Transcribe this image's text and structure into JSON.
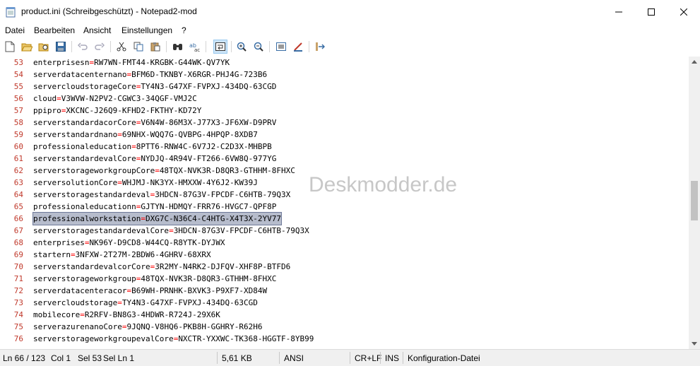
{
  "window": {
    "title": "product.ini (Schreibgeschützt) - Notepad2-mod",
    "buttons": [
      "minimize-icon",
      "maximize-icon",
      "close-icon"
    ]
  },
  "menu": [
    "Datei",
    "Bearbeiten",
    "Ansicht",
    "Einstellungen",
    "?"
  ],
  "toolbar": {
    "icons": [
      "new-file-icon",
      "open-folder-icon",
      "browse-icon",
      "save-icon",
      "undo-icon",
      "redo-icon",
      "cut-icon",
      "copy-icon",
      "paste-icon",
      "find-icon",
      "replace-icon",
      "word-wrap-icon",
      "zoom-in-icon",
      "zoom-out-icon",
      "scheme-icon",
      "customize-scheme-icon",
      "exit-icon"
    ],
    "active": "word-wrap-icon"
  },
  "editor": {
    "selected_line": "66",
    "lines": [
      {
        "n": "53",
        "key": "enterprisesn",
        "val": "RW7WN-FMT44-KRGBK-G44WK-QV7YK"
      },
      {
        "n": "54",
        "key": "serverdatacenternano",
        "val": "BFM6D-TKNBY-X6RGR-PHJ4G-723B6"
      },
      {
        "n": "55",
        "key": "servercloudstorageCore",
        "val": "TY4N3-G47XF-FVPXJ-434DQ-63CGD"
      },
      {
        "n": "56",
        "key": "cloud",
        "val": "V3WVW-N2PV2-CGWC3-34QGF-VMJ2C"
      },
      {
        "n": "57",
        "key": "ppipro",
        "val": "XKCNC-J26Q9-KFHD2-FKTHY-KD72Y"
      },
      {
        "n": "58",
        "key": "serverstandardacorCore",
        "val": "V6N4W-86M3X-J77X3-JF6XW-D9PRV"
      },
      {
        "n": "59",
        "key": "serverstandardnano",
        "val": "69NHX-WQQ7G-QVBPG-4HPQP-8XDB7"
      },
      {
        "n": "60",
        "key": "professionaleducation",
        "val": "8PTT6-RNW4C-6V7J2-C2D3X-MHBPB"
      },
      {
        "n": "61",
        "key": "serverstandardevalCore",
        "val": "NYDJQ-4R94V-FT266-6VW8Q-977YG"
      },
      {
        "n": "62",
        "key": "serverstorageworkgroupCore",
        "val": "48TQX-NVK3R-D8QR3-GTHHM-8FHXC"
      },
      {
        "n": "63",
        "key": "serversolutionCore",
        "val": "WHJMJ-NK3YX-HMXXW-4Y6J2-KW39J"
      },
      {
        "n": "64",
        "key": "serverstoragestandardeval",
        "val": "3HDCN-87G3V-FPCDF-C6HTB-79Q3X"
      },
      {
        "n": "65",
        "key": "professionaleducationn",
        "val": "GJTYN-HDMQY-FRR76-HVGC7-QPF8P"
      },
      {
        "n": "66",
        "key": "professionalworkstation",
        "val": "DXG7C-N36C4-C4HTG-X4T3X-2YV77"
      },
      {
        "n": "67",
        "key": "serverstoragestandardevalCore",
        "val": "3HDCN-87G3V-FPCDF-C6HTB-79Q3X"
      },
      {
        "n": "68",
        "key": "enterprises",
        "val": "NK96Y-D9CD8-W44CQ-R8YTK-DYJWX"
      },
      {
        "n": "69",
        "key": "startern",
        "val": "3NFXW-2T27M-2BDW6-4GHRV-68XRX"
      },
      {
        "n": "70",
        "key": "serverstandardevalcorCore",
        "val": "3R2MY-N4RK2-DJFQV-XHF8P-BTFD6"
      },
      {
        "n": "71",
        "key": "serverstorageworkgroup",
        "val": "48TQX-NVK3R-D8QR3-GTHHM-8FHXC"
      },
      {
        "n": "72",
        "key": "serverdatacenteracor",
        "val": "B69WH-PRNHK-BXVK3-P9XF7-XD84W"
      },
      {
        "n": "73",
        "key": "servercloudstorage",
        "val": "TY4N3-G47XF-FVPXJ-434DQ-63CGD"
      },
      {
        "n": "74",
        "key": "mobilecore",
        "val": "R2RFV-BN8G3-4HDWR-R724J-29X6K"
      },
      {
        "n": "75",
        "key": "serverazurenanoCore",
        "val": "9JQNQ-V8HQ6-PKB8H-GGHRY-R62H6"
      },
      {
        "n": "76",
        "key": "serverstorageworkgroupevalCore",
        "val": "NXCTR-YXXWC-TK368-HGGTF-8YB99"
      }
    ]
  },
  "watermark": "Deskmodder.de",
  "status": {
    "position": "Ln 66 / 123",
    "col": "Col 1",
    "sel": "Sel 53",
    "selln": "Sel Ln 1",
    "size": "5,61 KB",
    "encoding": "ANSI",
    "eol": "CR+LF",
    "ins": "INS",
    "scheme": "Konfiguration-Datei"
  }
}
